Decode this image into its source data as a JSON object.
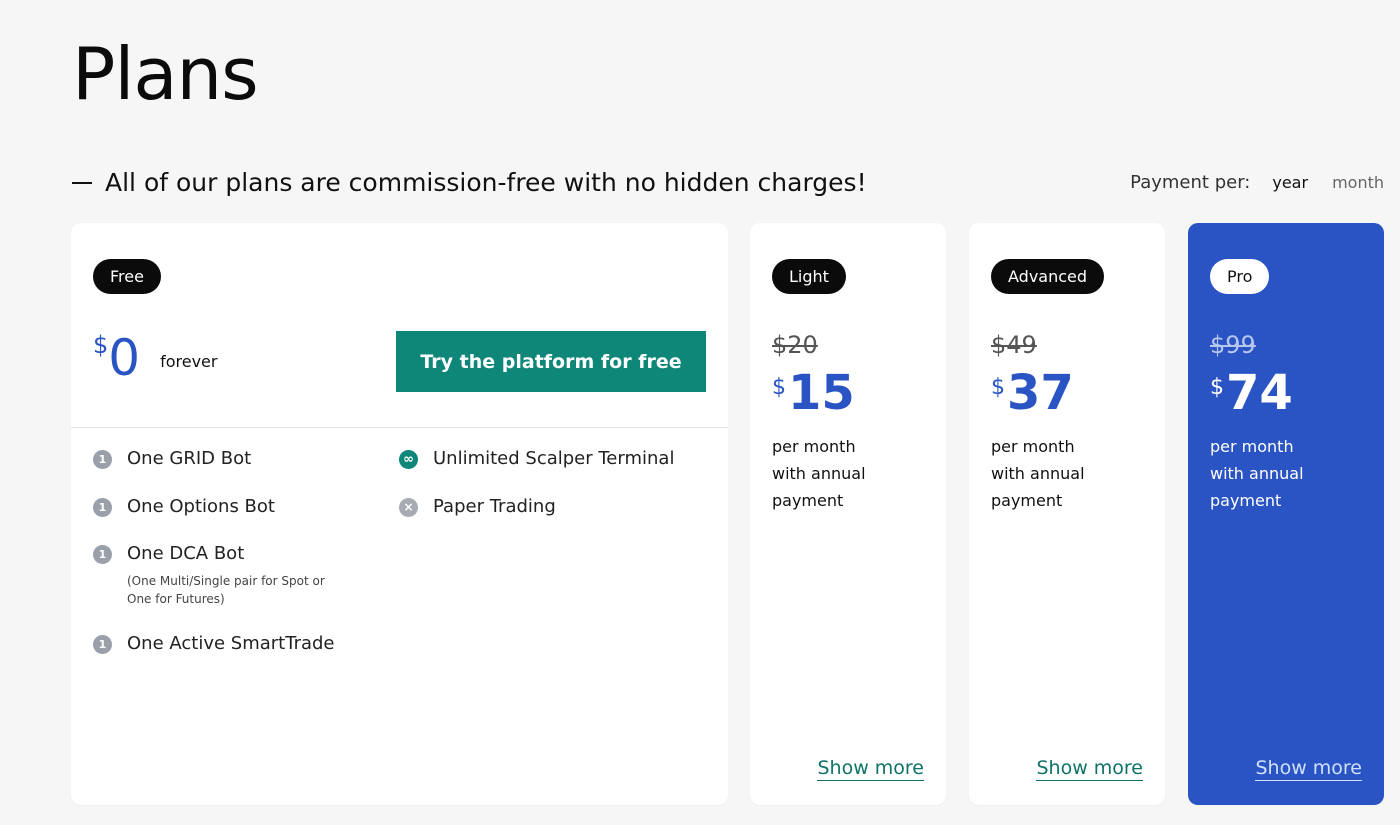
{
  "page": {
    "title": "Plans"
  },
  "subheader": "All of our plans are commission-free with no hidden charges!",
  "payment": {
    "label": "Payment per:",
    "options": [
      "year",
      "month"
    ],
    "selected": "year"
  },
  "colors": {
    "accent_blue": "#2a54c4",
    "accent_teal": "#0e8778",
    "badge_dark": "#0b0b0b"
  },
  "plans": {
    "free": {
      "badge": "Free",
      "currency": "$",
      "price": "0",
      "period": "forever",
      "cta": "Try the platform for free",
      "features_left": [
        {
          "icon": "1",
          "label": "One GRID Bot",
          "note": ""
        },
        {
          "icon": "1",
          "label": "One Options Bot",
          "note": ""
        },
        {
          "icon": "1",
          "label": "One DCA Bot",
          "note": "(One Multi/Single pair for Spot or One for Futures)"
        },
        {
          "icon": "1",
          "label": "One Active SmartTrade",
          "note": ""
        }
      ],
      "features_right": [
        {
          "icon": "∞",
          "label": "Unlimited Scalper Terminal"
        },
        {
          "icon": "×",
          "label": "Paper Trading"
        }
      ]
    },
    "light": {
      "badge": "Light",
      "old_price": "$20",
      "currency": "$",
      "price": "15",
      "per_lines": [
        "per month",
        "with annual",
        "payment"
      ],
      "show_more": "Show more"
    },
    "advanced": {
      "badge": "Advanced",
      "old_price": "$49",
      "currency": "$",
      "price": "37",
      "per_lines": [
        "per month",
        "with annual",
        "payment"
      ],
      "show_more": "Show more"
    },
    "pro": {
      "badge": "Pro",
      "old_price": "$99",
      "currency": "$",
      "price": "74",
      "per_lines": [
        "per month",
        "with annual",
        "payment"
      ],
      "show_more": "Show more"
    }
  }
}
